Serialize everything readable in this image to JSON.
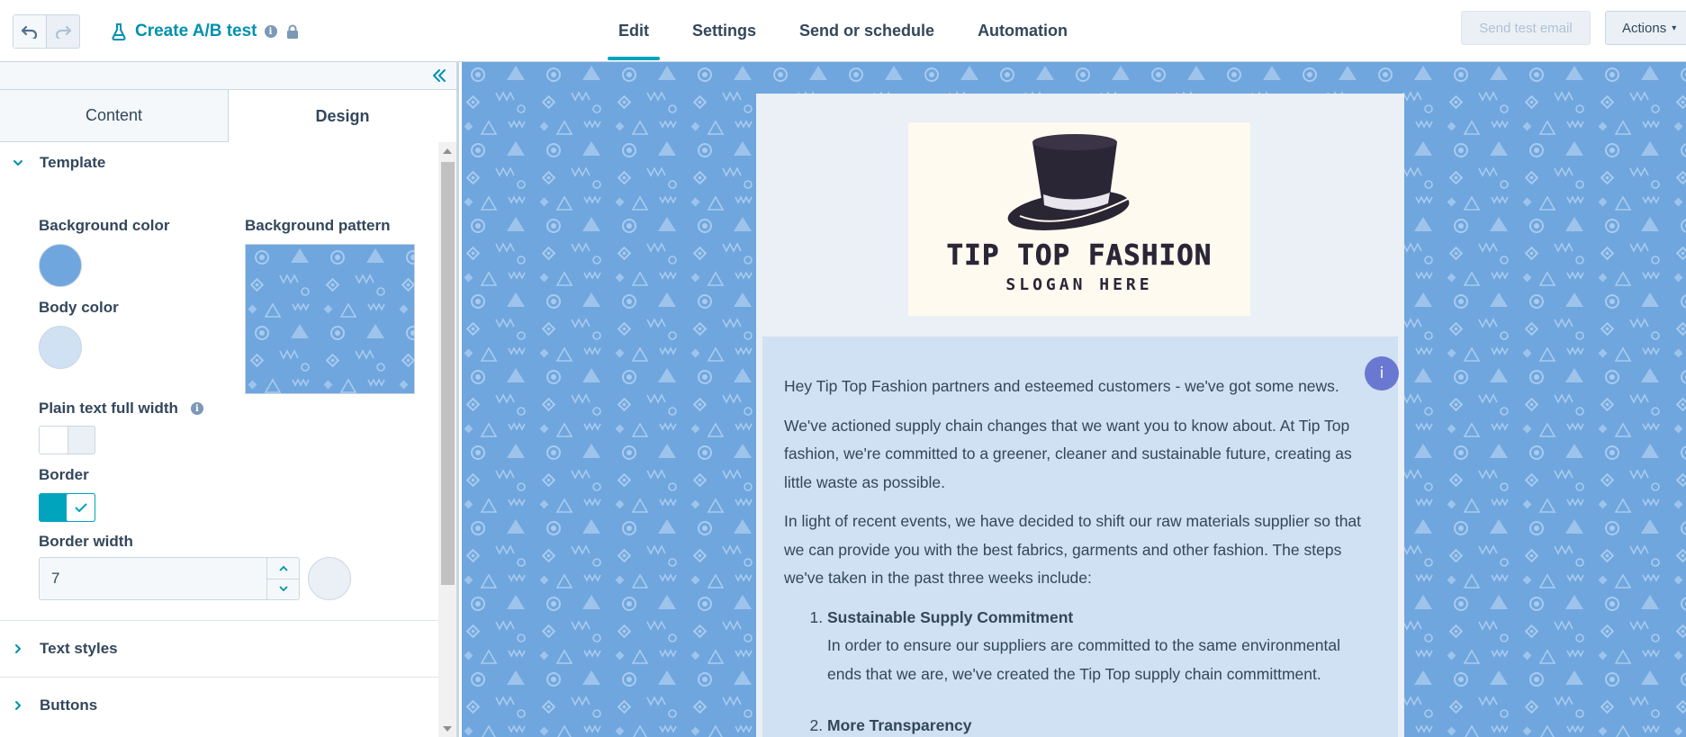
{
  "header": {
    "undo_icon": "undo-icon",
    "redo_icon": "redo-icon",
    "title": "Create A/B test",
    "info_glyph": "i",
    "tabs": [
      {
        "label": "Edit",
        "active": true
      },
      {
        "label": "Settings",
        "active": false
      },
      {
        "label": "Send or schedule",
        "active": false
      },
      {
        "label": "Automation",
        "active": false
      }
    ],
    "send_test_label": "Send test email",
    "actions_label": "Actions"
  },
  "sidebar": {
    "tabs": [
      {
        "label": "Content",
        "active": false
      },
      {
        "label": "Design",
        "active": true
      }
    ],
    "template": {
      "heading": "Template",
      "background_color_label": "Background color",
      "background_color": "#6fa6de",
      "background_pattern_label": "Background pattern",
      "body_color_label": "Body color",
      "body_color": "#cfe1f3",
      "plain_text_label": "Plain text full width",
      "plain_text_on": false,
      "border_label": "Border",
      "border_on": true,
      "border_width_label": "Border width",
      "border_width_value": "7"
    },
    "sections": [
      "Text styles",
      "Buttons"
    ]
  },
  "email": {
    "logo_title": "TIP TOP FASHION",
    "logo_slogan": "SLOGAN HERE",
    "info_bubble": "i",
    "paragraphs": [
      "Hey Tip Top Fashion partners and esteemed customers - we've got some news.",
      "We've actioned supply chain changes that we want you to know about. At Tip Top fashion, we're committed to a greener, cleaner and sustainable future, creating as little waste as possible.",
      "In light of recent events, we have decided to shift our raw materials supplier so that we can provide you with the best fabrics, garments and other fashion. The steps we've taken in the past three weeks include:"
    ],
    "list": [
      {
        "title": "Sustainable Supply Commitment",
        "body": "In order to ensure our suppliers are committed to the same environmental ends that we are, we've created the Tip Top supply chain committment."
      },
      {
        "title": "More Transparency",
        "body": ""
      }
    ]
  },
  "colors": {
    "accent": "#00a4bd",
    "link": "#0091ae",
    "text": "#33475b",
    "canvas_bg": "#6fa6de"
  }
}
